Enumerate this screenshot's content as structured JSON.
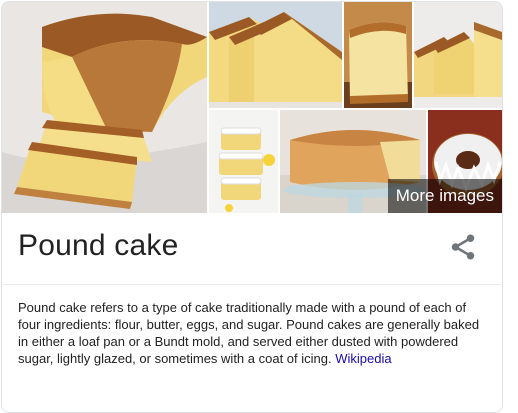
{
  "panel": {
    "title": "Pound cake",
    "description": "Pound cake refers to a type of cake traditionally made with a pound of each of four ingredients: flour, butter, eggs, and sugar. Pound cakes are generally baked in either a loaf pan or a Bundt mold, and served either dusted with powdered sugar, lightly glazed, or sometimes with a coat of icing.",
    "source_link": "Wikipedia",
    "share_icon": "share-icon"
  },
  "gallery": {
    "more_images_label": "More images",
    "images": [
      {
        "subject": "loaf-with-slices"
      },
      {
        "subject": "sliced-loaf"
      },
      {
        "subject": "single-slice"
      },
      {
        "subject": "slices-stack"
      },
      {
        "subject": "glazed-slices-stack"
      },
      {
        "subject": "cake-on-glass-stand"
      },
      {
        "subject": "glazed-bundt-cake"
      }
    ]
  },
  "colors": {
    "link": "#1a0dab",
    "crust": "#b5651d",
    "crumb": "#f2d77a"
  }
}
